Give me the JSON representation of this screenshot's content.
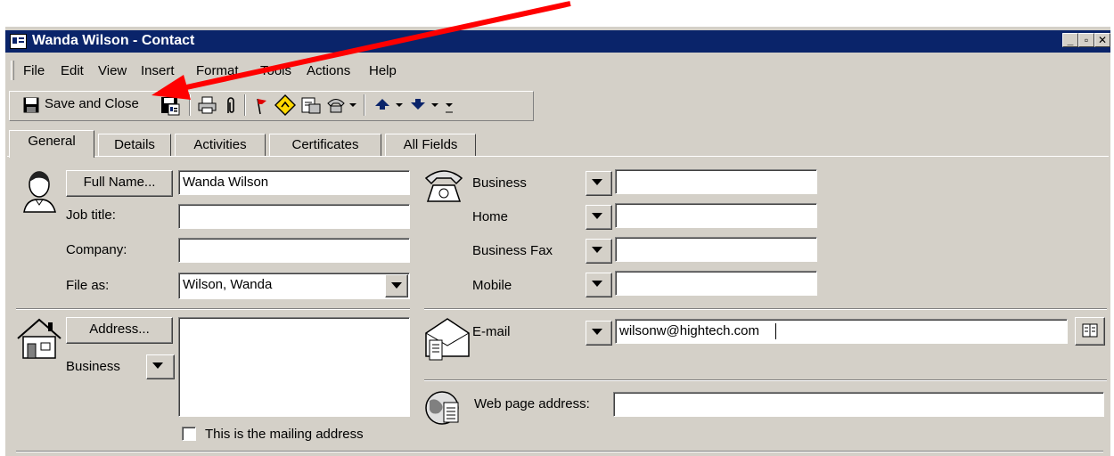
{
  "window": {
    "title": "Wanda Wilson - Contact",
    "controls": [
      "minimize",
      "restore",
      "close"
    ]
  },
  "menu": [
    "File",
    "Edit",
    "View",
    "Insert",
    "Format",
    "Tools",
    "Actions",
    "Help"
  ],
  "toolbar": {
    "save_close_label": "Save and Close",
    "icons": [
      "save-icon",
      "save-new-icon",
      "print-icon",
      "attach-icon",
      "flag-icon",
      "activities-icon",
      "new-message-icon",
      "dial-icon",
      "previous-icon",
      "next-icon"
    ]
  },
  "tabs": [
    "General",
    "Details",
    "Activities",
    "Certificates",
    "All Fields"
  ],
  "general": {
    "full_name_button": "Full Name...",
    "full_name_value": "Wanda Wilson",
    "job_title_label": "Job title:",
    "job_title_value": "",
    "company_label": "Company:",
    "company_value": "",
    "file_as_label": "File as:",
    "file_as_value": "Wilson, Wanda",
    "address_button": "Address...",
    "address_type": "Business",
    "address_value": "",
    "mailing_label": "This is the mailing address",
    "mailing_checked": false
  },
  "phones": [
    {
      "label": "Business",
      "value": ""
    },
    {
      "label": "Home",
      "value": ""
    },
    {
      "label": "Business Fax",
      "value": ""
    },
    {
      "label": "Mobile",
      "value": ""
    }
  ],
  "email": {
    "label": "E-mail",
    "value": "wilsonw@hightech.com"
  },
  "web": {
    "label": "Web page address:",
    "value": ""
  },
  "colors": {
    "titlebar": "#0a246a",
    "face": "#d4d0c8",
    "annotation_arrow": "#ff0000"
  }
}
